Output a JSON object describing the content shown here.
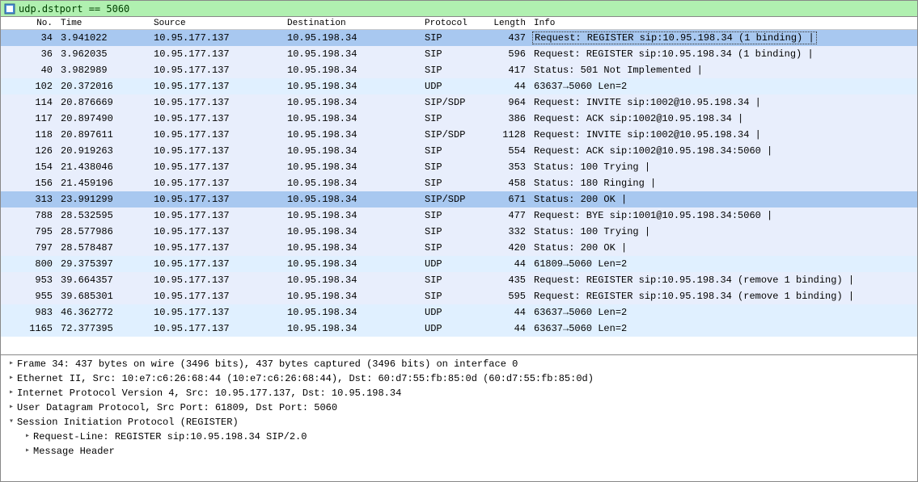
{
  "filter": {
    "text": "udp.dstport == 5060"
  },
  "columns": {
    "no": "No.",
    "time": "Time",
    "source": "Source",
    "dest": "Destination",
    "proto": "Protocol",
    "len": "Length",
    "info": "Info"
  },
  "rows": [
    {
      "no": "34",
      "time": "3.941022",
      "source": "10.95.177.137",
      "dest": "10.95.198.34",
      "proto": "SIP",
      "len": "437",
      "info": "Request: REGISTER sip:10.95.198.34  (1 binding) |",
      "bg": "sip",
      "selected": true
    },
    {
      "no": "36",
      "time": "3.962035",
      "source": "10.95.177.137",
      "dest": "10.95.198.34",
      "proto": "SIP",
      "len": "596",
      "info": "Request: REGISTER sip:10.95.198.34  (1 binding) |",
      "bg": "sip"
    },
    {
      "no": "40",
      "time": "3.982989",
      "source": "10.95.177.137",
      "dest": "10.95.198.34",
      "proto": "SIP",
      "len": "417",
      "info": "Status: 501 Not Implemented |",
      "bg": "sip"
    },
    {
      "no": "102",
      "time": "20.372016",
      "source": "10.95.177.137",
      "dest": "10.95.198.34",
      "proto": "UDP",
      "len": "44",
      "info": "63637→5060 Len=2",
      "bg": "udp"
    },
    {
      "no": "114",
      "time": "20.876669",
      "source": "10.95.177.137",
      "dest": "10.95.198.34",
      "proto": "SIP/SDP",
      "len": "964",
      "info": "Request: INVITE sip:1002@10.95.198.34 |",
      "bg": "sip"
    },
    {
      "no": "117",
      "time": "20.897490",
      "source": "10.95.177.137",
      "dest": "10.95.198.34",
      "proto": "SIP",
      "len": "386",
      "info": "Request: ACK sip:1002@10.95.198.34 |",
      "bg": "sip"
    },
    {
      "no": "118",
      "time": "20.897611",
      "source": "10.95.177.137",
      "dest": "10.95.198.34",
      "proto": "SIP/SDP",
      "len": "1128",
      "info": "Request: INVITE sip:1002@10.95.198.34 |",
      "bg": "sip"
    },
    {
      "no": "126",
      "time": "20.919263",
      "source": "10.95.177.137",
      "dest": "10.95.198.34",
      "proto": "SIP",
      "len": "554",
      "info": "Request: ACK sip:1002@10.95.198.34:5060 |",
      "bg": "sip"
    },
    {
      "no": "154",
      "time": "21.438046",
      "source": "10.95.177.137",
      "dest": "10.95.198.34",
      "proto": "SIP",
      "len": "353",
      "info": "Status: 100 Trying |",
      "bg": "sip"
    },
    {
      "no": "156",
      "time": "21.459196",
      "source": "10.95.177.137",
      "dest": "10.95.198.34",
      "proto": "SIP",
      "len": "458",
      "info": "Status: 180 Ringing |",
      "bg": "sip"
    },
    {
      "no": "313",
      "time": "23.991299",
      "source": "10.95.177.137",
      "dest": "10.95.198.34",
      "proto": "SIP/SDP",
      "len": "671",
      "info": "Status: 200 OK |",
      "bg": "sip",
      "selected": true
    },
    {
      "no": "788",
      "time": "28.532595",
      "source": "10.95.177.137",
      "dest": "10.95.198.34",
      "proto": "SIP",
      "len": "477",
      "info": "Request: BYE sip:1001@10.95.198.34:5060 |",
      "bg": "sip"
    },
    {
      "no": "795",
      "time": "28.577986",
      "source": "10.95.177.137",
      "dest": "10.95.198.34",
      "proto": "SIP",
      "len": "332",
      "info": "Status: 100 Trying |",
      "bg": "sip"
    },
    {
      "no": "797",
      "time": "28.578487",
      "source": "10.95.177.137",
      "dest": "10.95.198.34",
      "proto": "SIP",
      "len": "420",
      "info": "Status: 200 OK |",
      "bg": "sip"
    },
    {
      "no": "800",
      "time": "29.375397",
      "source": "10.95.177.137",
      "dest": "10.95.198.34",
      "proto": "UDP",
      "len": "44",
      "info": "61809→5060 Len=2",
      "bg": "udp"
    },
    {
      "no": "953",
      "time": "39.664357",
      "source": "10.95.177.137",
      "dest": "10.95.198.34",
      "proto": "SIP",
      "len": "435",
      "info": "Request: REGISTER sip:10.95.198.34  (remove 1 binding) |",
      "bg": "sip"
    },
    {
      "no": "955",
      "time": "39.685301",
      "source": "10.95.177.137",
      "dest": "10.95.198.34",
      "proto": "SIP",
      "len": "595",
      "info": "Request: REGISTER sip:10.95.198.34  (remove 1 binding) |",
      "bg": "sip"
    },
    {
      "no": "983",
      "time": "46.362772",
      "source": "10.95.177.137",
      "dest": "10.95.198.34",
      "proto": "UDP",
      "len": "44",
      "info": "63637→5060 Len=2",
      "bg": "udp"
    },
    {
      "no": "1165",
      "time": "72.377395",
      "source": "10.95.177.137",
      "dest": "10.95.198.34",
      "proto": "UDP",
      "len": "44",
      "info": "63637→5060 Len=2",
      "bg": "udp"
    }
  ],
  "details": [
    {
      "indent": 0,
      "expander": ">",
      "text": "Frame 34: 437 bytes on wire (3496 bits), 437 bytes captured (3496 bits) on interface 0"
    },
    {
      "indent": 0,
      "expander": ">",
      "text": "Ethernet II, Src: 10:e7:c6:26:68:44 (10:e7:c6:26:68:44), Dst: 60:d7:55:fb:85:0d (60:d7:55:fb:85:0d)"
    },
    {
      "indent": 0,
      "expander": ">",
      "text": "Internet Protocol Version 4, Src: 10.95.177.137, Dst: 10.95.198.34"
    },
    {
      "indent": 0,
      "expander": ">",
      "text": "User Datagram Protocol, Src Port: 61809, Dst Port: 5060"
    },
    {
      "indent": 0,
      "expander": "v",
      "text": "Session Initiation Protocol (REGISTER)"
    },
    {
      "indent": 1,
      "expander": ">",
      "text": "Request-Line: REGISTER sip:10.95.198.34 SIP/2.0"
    },
    {
      "indent": 1,
      "expander": ">",
      "text": "Message Header"
    }
  ]
}
